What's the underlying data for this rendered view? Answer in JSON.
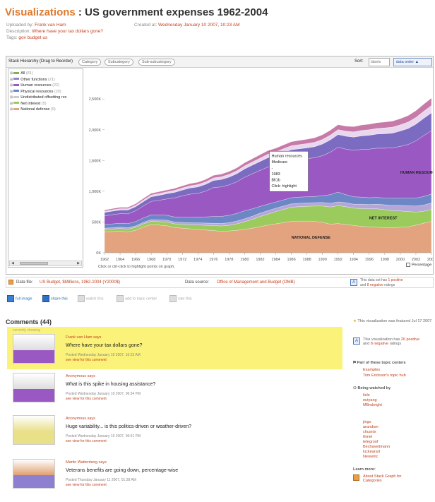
{
  "header": {
    "crumb": "Visualizations",
    "sep": " : ",
    "title": "US government expenses 1962-2004",
    "uploaded_label": "Uploaded by:",
    "uploaded_by": "Frank van Ham",
    "description_label": "Description:",
    "description": "Where have your tax dollars gone?",
    "tags_label": "Tags:",
    "tags": "gov budget us",
    "created_label": "Created at:",
    "created_at": "Wednesday January 10 2007, 10:23 AM"
  },
  "toolbar": {
    "stack_label": "Stack Hierarchy (Drag to Reorder)",
    "pills": [
      "Category",
      "Subcategory",
      "Sub-subcategory"
    ],
    "sort_label": "Sort:",
    "labels_btn": "labels",
    "data_order_btn": "data order ▲"
  },
  "tree": [
    {
      "label": "All",
      "count": "(81)",
      "color": "#7fb24a"
    },
    {
      "label": "Other functions",
      "count": "(21)",
      "color": "#8e86c8"
    },
    {
      "label": "Human resources",
      "count": "(22)",
      "color": "#9a59c2"
    },
    {
      "label": "Physical resources",
      "count": "(20)",
      "color": "#6d86c6"
    },
    {
      "label": "Undistributed offsetting rec",
      "count": "",
      "color": "#cccccc"
    },
    {
      "label": "Net interest",
      "count": "(5)",
      "color": "#9acb5c"
    },
    {
      "label": "National defense",
      "count": "(9)",
      "color": "#e3a37f"
    }
  ],
  "chart_data": {
    "type": "area",
    "stacked": true,
    "x": [
      1962,
      1963,
      1964,
      1965,
      1966,
      1967,
      1968,
      1969,
      1970,
      1971,
      1972,
      1973,
      1974,
      1975,
      1976,
      1977,
      1978,
      1979,
      1980,
      1981,
      1982,
      1983,
      1984,
      1985,
      1986,
      1987,
      1988,
      1989,
      1990,
      1991,
      1992,
      1993,
      1994,
      1995,
      1996,
      1997,
      1998,
      1999,
      2000,
      2001,
      2002,
      2003,
      2004
    ],
    "xticks": [
      "1962",
      "1964",
      "1966",
      "1968",
      "1970",
      "1972",
      "1974",
      "1976",
      "1978",
      "1980",
      "1982",
      "1984",
      "1986",
      "1988",
      "1990",
      "1992",
      "1994",
      "1996",
      "1998",
      "2000",
      "2002",
      "2004"
    ],
    "ytick_labels": [
      "0K",
      "500K",
      "1,000K",
      "1,500K",
      "2,000K",
      "2,500K"
    ],
    "ylim": [
      0,
      2950000
    ],
    "series": [
      {
        "name": "NATIONAL DEFENSE",
        "color": "#e3a37f",
        "values": [
          340,
          345,
          350,
          340,
          365,
          420,
          460,
          450,
          440,
          410,
          400,
          390,
          380,
          370,
          360,
          350,
          355,
          365,
          380,
          400,
          425,
          450,
          470,
          490,
          510,
          515,
          515,
          510,
          495,
          465,
          475,
          460,
          445,
          430,
          420,
          415,
          410,
          410,
          415,
          420,
          450,
          480,
          510
        ]
      },
      {
        "name": "NET INTEREST",
        "color": "#9acb5c",
        "values": [
          40,
          42,
          44,
          45,
          48,
          50,
          52,
          55,
          60,
          60,
          62,
          66,
          72,
          78,
          82,
          86,
          92,
          105,
          125,
          145,
          165,
          180,
          200,
          215,
          230,
          235,
          240,
          250,
          265,
          280,
          290,
          290,
          280,
          290,
          295,
          300,
          290,
          275,
          265,
          250,
          210,
          195,
          195
        ]
      },
      {
        "name": "",
        "color": "#b5a6d8",
        "values": [
          20,
          20,
          22,
          22,
          25,
          25,
          28,
          30,
          30,
          30,
          32,
          32,
          34,
          35,
          38,
          40,
          42,
          45,
          48,
          50,
          55,
          55,
          55,
          55,
          55,
          55,
          55,
          55,
          58,
          60,
          62,
          65,
          65,
          70,
          70,
          75,
          80,
          85,
          90,
          95,
          100,
          100,
          105
        ]
      },
      {
        "name": "",
        "color": "#6d86c6",
        "values": [
          60,
          62,
          64,
          66,
          70,
          72,
          75,
          78,
          80,
          82,
          86,
          90,
          95,
          100,
          110,
          115,
          120,
          125,
          130,
          120,
          110,
          105,
          100,
          100,
          100,
          100,
          100,
          100,
          110,
          140,
          160,
          130,
          120,
          115,
          110,
          110,
          110,
          115,
          120,
          125,
          130,
          140,
          145
        ]
      },
      {
        "name": "HUMAN RESOURCES",
        "color": "#9a59c2",
        "values": [
          140,
          150,
          155,
          160,
          175,
          195,
          220,
          240,
          265,
          310,
          345,
          375,
          385,
          420,
          470,
          480,
          495,
          515,
          545,
          570,
          585,
          605,
          600,
          610,
          615,
          615,
          620,
          630,
          650,
          690,
          730,
          740,
          755,
          775,
          790,
          800,
          810,
          820,
          840,
          870,
          930,
          990,
          1030
        ]
      },
      {
        "name": "",
        "color": "#7b6cc2",
        "values": [
          55,
          58,
          60,
          62,
          66,
          70,
          75,
          80,
          85,
          90,
          95,
          100,
          105,
          110,
          115,
          120,
          125,
          130,
          135,
          140,
          145,
          150,
          155,
          160,
          165,
          170,
          175,
          180,
          190,
          200,
          205,
          210,
          215,
          220,
          225,
          230,
          235,
          240,
          250,
          260,
          270,
          280,
          290
        ]
      },
      {
        "name": "",
        "color": "#e9d7ef",
        "values": [
          20,
          20,
          22,
          22,
          24,
          26,
          28,
          30,
          30,
          32,
          34,
          36,
          38,
          40,
          42,
          44,
          46,
          48,
          50,
          52,
          55,
          58,
          60,
          62,
          65,
          68,
          70,
          72,
          75,
          78,
          80,
          82,
          85,
          88,
          90,
          92,
          95,
          98,
          100,
          105,
          110,
          115,
          120
        ]
      },
      {
        "name": "",
        "color": "#c77aa8",
        "values": [
          20,
          20,
          22,
          22,
          24,
          26,
          28,
          30,
          30,
          32,
          34,
          36,
          38,
          40,
          42,
          44,
          46,
          48,
          50,
          52,
          55,
          58,
          60,
          62,
          65,
          68,
          70,
          72,
          75,
          78,
          80,
          82,
          85,
          88,
          90,
          92,
          95,
          98,
          100,
          105,
          110,
          115,
          120
        ]
      }
    ],
    "tooltip": [
      "Human resources",
      "Medicare",
      "-",
      "1983",
      "$61b",
      "Click: highlight"
    ]
  },
  "chart_labels": {
    "note": "Click or ctrl-click to highlight points on graph.",
    "percentage": "Percentage"
  },
  "datafile": {
    "label": "Data file:",
    "file": "US Budget, $Millions, 1962-2004 (Y2000$)",
    "source_label": "Data source:",
    "source": "Office of Management and Budget (OMB)",
    "rating_a": "This data set has",
    "positive": "1 positive",
    "rating_b": "and",
    "negative": "8 negative",
    "rating_c": "ratings"
  },
  "actions": [
    {
      "label": "full image",
      "icon": "full-image-icon",
      "active": true
    },
    {
      "label": "share this",
      "icon": "share-icon",
      "active": true
    },
    {
      "label": "watch this",
      "icon": "watch-icon",
      "active": false
    },
    {
      "label": "add to topic center",
      "icon": "add-topic-icon",
      "active": false
    },
    {
      "label": "rate this",
      "icon": "rate-icon",
      "active": false
    }
  ],
  "comments": {
    "heading": "Comments (44)",
    "currently_showing": "currently showing",
    "items": [
      {
        "author": "Frank van Ham says",
        "text": "Where have your tax dollars gone?",
        "date": "Posted Wednesday January 10 2007, 10:23 AM",
        "link": "see view for this comment",
        "highlight": true
      },
      {
        "author": "Anonymous says",
        "text": "What is this spike in housing assistance?",
        "date": "Posted Wednesday January 10 2007, 06:34 PM",
        "link": "see view for this comment",
        "highlight": false
      },
      {
        "author": "Anonymous says",
        "text": "Huge variability... is this politics-driven or weather-driven?",
        "date": "Posted Wednesday January 10 2007, 06:51 PM",
        "link": "see view for this comment",
        "highlight": false
      },
      {
        "author": "Martin Wattenberg says",
        "text": "Veterans benefits are going down, percentage-wise",
        "date": "Posted Thursday January 11 2007, 01:28 AM",
        "link": "see view for this comment",
        "highlight": false
      }
    ]
  },
  "sidebar": {
    "featured": "This visualization was featured Jul 17 2007",
    "rated_a": "This visualization has",
    "rated_pos": "26 positive",
    "rated_b": "and",
    "rated_neg": "8 negative",
    "rated_c": "ratings",
    "topics_head": "Part of these topic centers",
    "topics": [
      "Examples",
      "Tom Erickson's topic hub"
    ],
    "watched_head": "Being watched by",
    "watchers": [
      "ilele",
      "nutyang",
      "MBrubright"
    ],
    "others": [
      "jingo",
      "arandom",
      "chusnix",
      "thiriel",
      "telegroof",
      "Bechavedmann",
      "luckearart",
      "Neowmc"
    ],
    "learn_head": "Learn more:",
    "learn_link": "About Stack Graph for Categories"
  }
}
